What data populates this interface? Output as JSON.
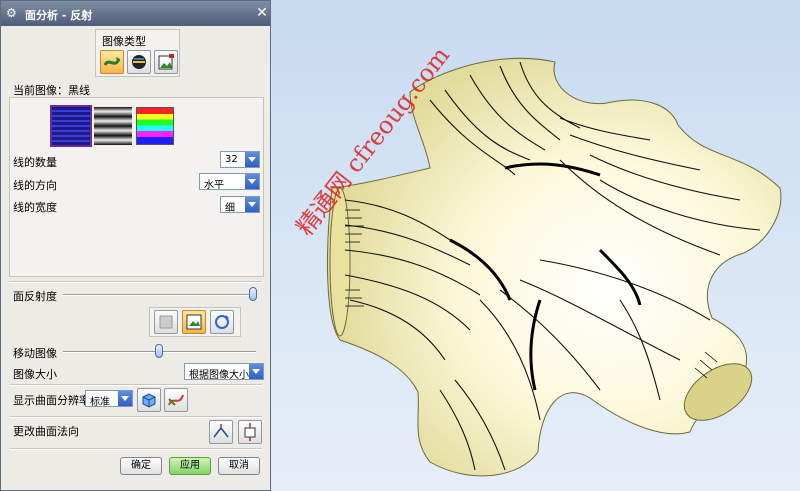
{
  "dialog": {
    "title": "面分析 - 反射",
    "image_type_group": "图像类型",
    "current_image_label": "当前图像：黑线",
    "line_count_label": "线的数量",
    "line_count_value": "32",
    "line_direction_label": "线的方向",
    "line_direction_value": "水平",
    "line_width_label": "线的宽度",
    "line_width_value": "细",
    "reflectivity_label": "面反射度",
    "reflectivity_level": 1.0,
    "move_image_label": "移动图像",
    "move_image_level": 0.6,
    "image_size_label": "图像大小",
    "image_size_value": "根据图像大小",
    "resolution_label": "显示曲面分辨率",
    "resolution_value": "标准",
    "normal_label": "更改曲面法向",
    "ok_label": "确定",
    "apply_label": "应用",
    "cancel_label": "取消"
  },
  "colors": {
    "accent": "#4e5e78",
    "surface": "#f7f3c6",
    "apply": "#84d266"
  },
  "watermark": "精通网 cfreoug.com"
}
